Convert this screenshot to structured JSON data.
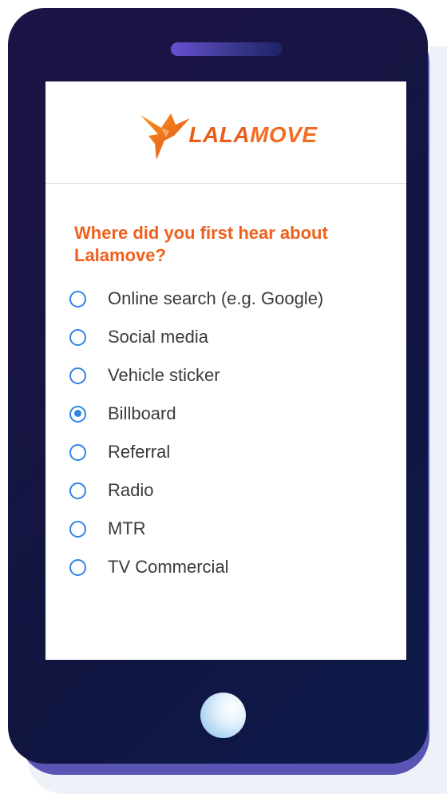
{
  "app": {
    "brand": {
      "part1": "LALA",
      "part2": "MOVE"
    }
  },
  "survey": {
    "question": "Where did you first hear about Lalamove?",
    "selected_index": 3,
    "options": [
      {
        "label": "Online search (e.g. Google)",
        "checked": false
      },
      {
        "label": "Social media",
        "checked": false
      },
      {
        "label": "Vehicle sticker",
        "checked": false
      },
      {
        "label": "Billboard",
        "checked": true
      },
      {
        "label": "Referral",
        "checked": false
      },
      {
        "label": "Radio",
        "checked": false
      },
      {
        "label": "MTR",
        "checked": false
      },
      {
        "label": "TV Commercial",
        "checked": false
      }
    ]
  },
  "colors": {
    "accent_orange": "#f0601c",
    "radio_blue": "#2f84e6",
    "phone_body": "#111540"
  },
  "icons": {
    "logo": "hummingbird-logo-icon",
    "home": "home-button-icon",
    "speaker": "speaker-grille-icon"
  }
}
